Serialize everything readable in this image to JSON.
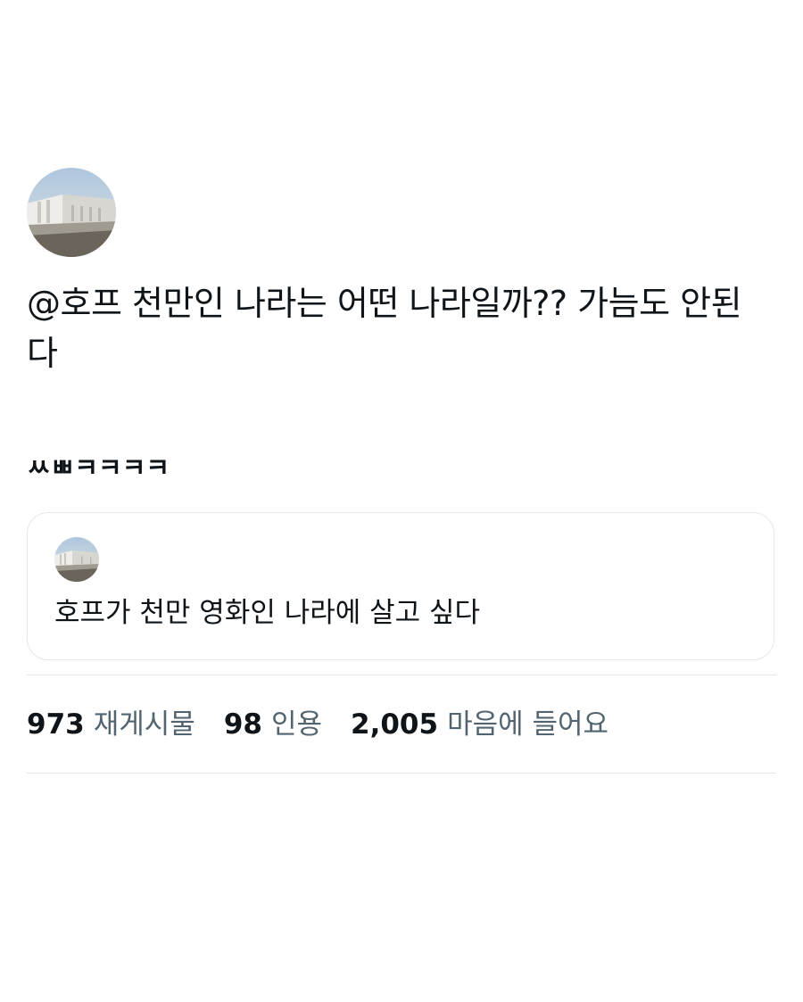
{
  "tweet": {
    "avatar": "profile-photo-building",
    "text": "@호프 천만인 나라는 어떤 나라일까?? 가늠도 안된다"
  },
  "comment": "ㅆㅃㅋㅋㅋㅋ",
  "quoted_tweet": {
    "avatar": "profile-photo-building",
    "text": "호프가 천만 영화인 나라에 살고 싶다"
  },
  "stats": {
    "reposts_count": "973",
    "reposts_label": "재게시물",
    "quotes_count": "98",
    "quotes_label": "인용",
    "likes_count": "2,005",
    "likes_label": "마음에 들어요"
  },
  "colors": {
    "text_primary": "#0f1419",
    "text_secondary": "#536471",
    "border": "#e3e7ea"
  }
}
